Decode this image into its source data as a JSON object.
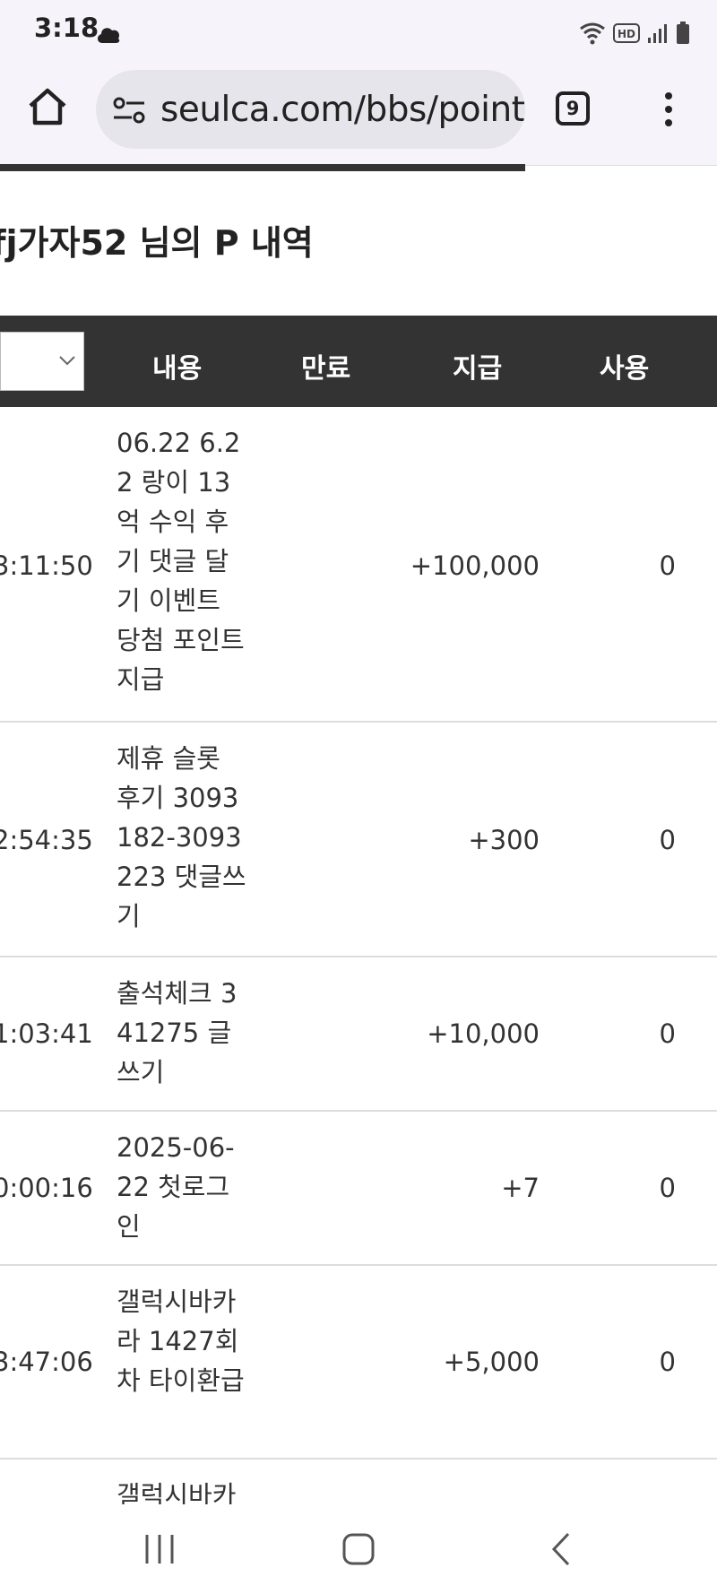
{
  "status": {
    "time": "3:18"
  },
  "browser": {
    "url": "seulca.com/bbs/point.p",
    "tab_count": "9"
  },
  "page": {
    "title": "fj가자52 님의 P 내역"
  },
  "table": {
    "headers": {
      "content": "내용",
      "expire": "만료",
      "give": "지급",
      "use": "사용"
    },
    "rows": [
      {
        "time": "3:11:50",
        "content": "06.22 6.22 랑이 13억 수익 후기 댓글 달기 이벤트 당첨 포인트 지급",
        "give": "+100,000",
        "use": "0"
      },
      {
        "time": "2:54:35",
        "content": "제휴 슬롯 후기 3093182-3093223 댓글쓰기",
        "give": "+300",
        "use": "0"
      },
      {
        "time": "1:03:41",
        "content": "출석체크 341275 글쓰기",
        "give": "+10,000",
        "use": "0"
      },
      {
        "time": "0:00:16",
        "content": "2025-06-22 첫로그인",
        "give": "+7",
        "use": "0"
      },
      {
        "time": "3:47:06",
        "content": "갤럭시바카라 1427회차 타이환급",
        "give": "+5,000",
        "use": "0"
      },
      {
        "time": "",
        "content": "갤럭시바카",
        "give": "",
        "use": ""
      }
    ]
  }
}
